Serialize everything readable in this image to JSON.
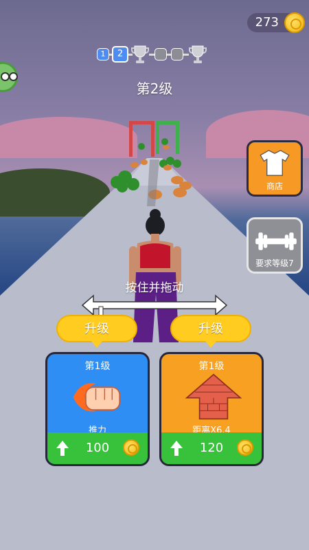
{
  "hud": {
    "coins": "273",
    "level_title": "第2级",
    "progress": {
      "levels": [
        "1",
        "2",
        "",
        ""
      ],
      "current_index": 1
    }
  },
  "side": {
    "shop_label": "商店",
    "gym_label": "要求等级7"
  },
  "hint": {
    "drag_text": "按住并拖动"
  },
  "upgrades": [
    {
      "tab_label": "升级",
      "level": "第1级",
      "name": "推力",
      "price": "100",
      "color": "#2f8ef3"
    },
    {
      "tab_label": "升级",
      "level": "第1级",
      "name": "距离X6.4",
      "price": "120",
      "color": "#f7a021"
    }
  ]
}
